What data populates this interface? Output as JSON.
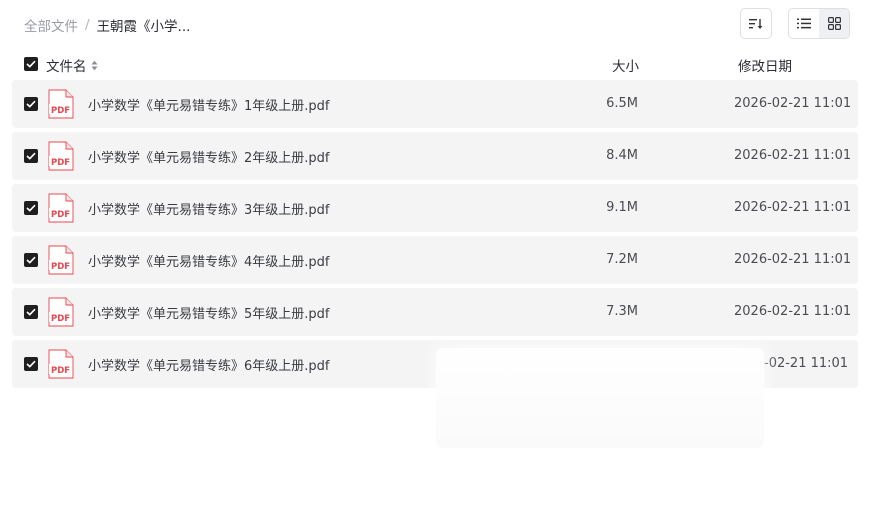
{
  "breadcrumb": {
    "root": "全部文件",
    "separator": "/",
    "current": "王朝霞《小学..."
  },
  "toolbar": {
    "sort_icon": "sort-descending-icon",
    "list_view_icon": "list-view-icon",
    "grid_view_icon": "grid-view-icon",
    "active_view": "list"
  },
  "table": {
    "columns": {
      "name": "文件名",
      "size": "大小",
      "date": "修改日期"
    },
    "all_selected": true,
    "rows": [
      {
        "name": "小学数学《单元易错专练》1年级上册.pdf",
        "size": "6.5M",
        "date": "2026-02-21 11:01",
        "selected": true,
        "icon": "pdf-file-icon"
      },
      {
        "name": "小学数学《单元易错专练》2年级上册.pdf",
        "size": "8.4M",
        "date": "2026-02-21 11:01",
        "selected": true,
        "icon": "pdf-file-icon"
      },
      {
        "name": "小学数学《单元易错专练》3年级上册.pdf",
        "size": "9.1M",
        "date": "2026-02-21 11:01",
        "selected": true,
        "icon": "pdf-file-icon"
      },
      {
        "name": "小学数学《单元易错专练》4年级上册.pdf",
        "size": "7.2M",
        "date": "2026-02-21 11:01",
        "selected": true,
        "icon": "pdf-file-icon"
      },
      {
        "name": "小学数学《单元易错专练》5年级上册.pdf",
        "size": "7.3M",
        "date": "2026-02-21 11:01",
        "selected": true,
        "icon": "pdf-file-icon"
      },
      {
        "name": "小学数学《单元易错专练》6年级上册.pdf",
        "size": "",
        "date": "-02-21 11:01",
        "selected": true,
        "icon": "pdf-file-icon"
      }
    ]
  },
  "pdf_badge_text": "PDF",
  "colors": {
    "pdf_red": "#e5484d",
    "row_bg": "#f4f4f5",
    "checkbox": "#1f1f1f"
  }
}
